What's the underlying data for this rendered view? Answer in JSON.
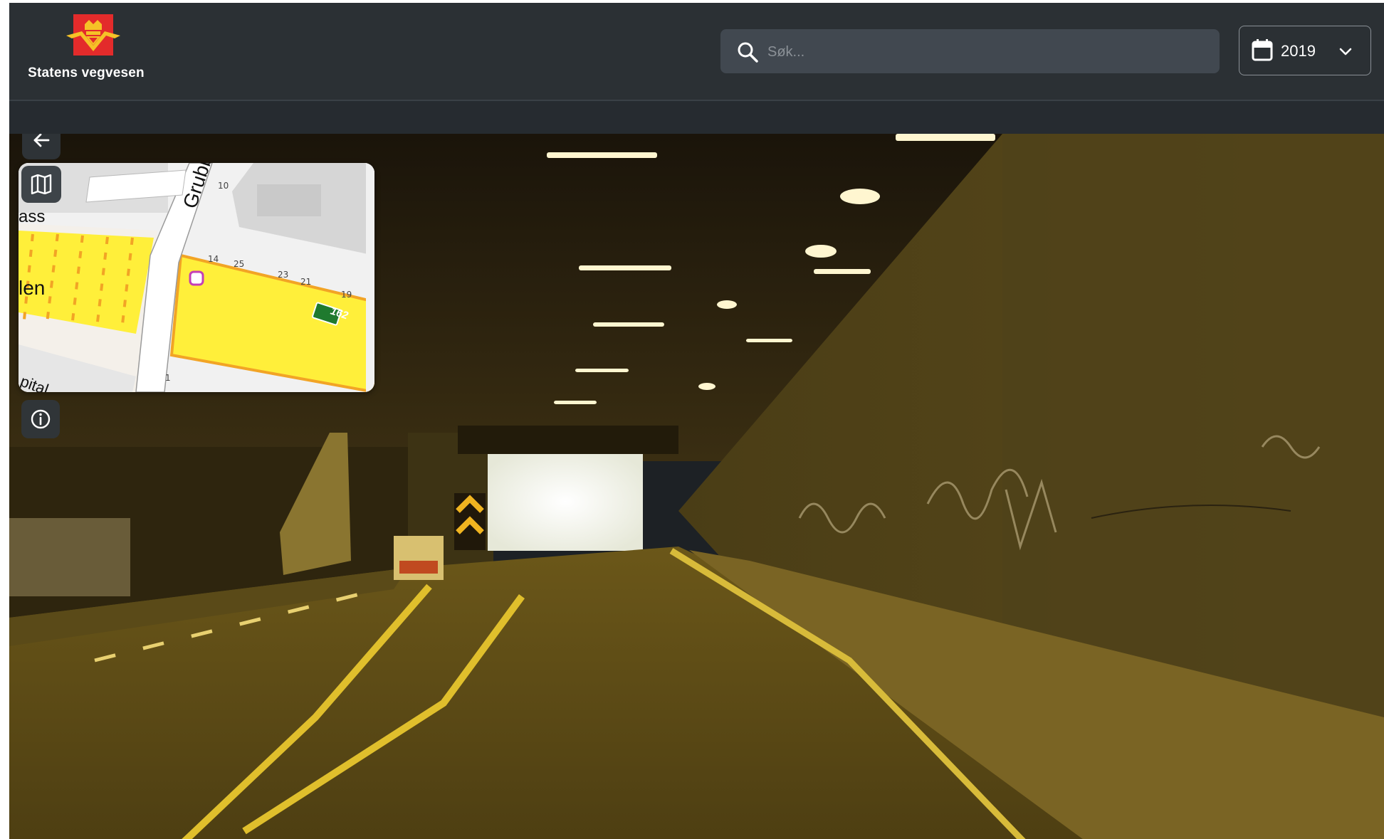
{
  "header": {
    "brand": "Statens vegvesen",
    "search": {
      "placeholder": "Søk...",
      "value": ""
    },
    "year_selector": {
      "value": "2019"
    }
  },
  "minimap": {
    "street_labels": [
      "Grubb",
      "ass",
      "len",
      "pital"
    ],
    "house_numbers": [
      "10",
      "14",
      "25",
      "23",
      "21",
      "19",
      "1"
    ],
    "road_badge": "162",
    "colors": {
      "major_road": "#ffef3a",
      "road_border": "#f2a425",
      "badge": "#1f7a2e",
      "marker": "#c43fb6"
    }
  },
  "icons": [
    "logo-mark",
    "search-icon",
    "calendar-icon",
    "chevron-down-icon",
    "arrow-left-icon",
    "map-icon",
    "info-icon"
  ],
  "colors": {
    "header_bg": "#2b3034",
    "search_bg": "#414850",
    "logo_red": "#e32b2b"
  }
}
